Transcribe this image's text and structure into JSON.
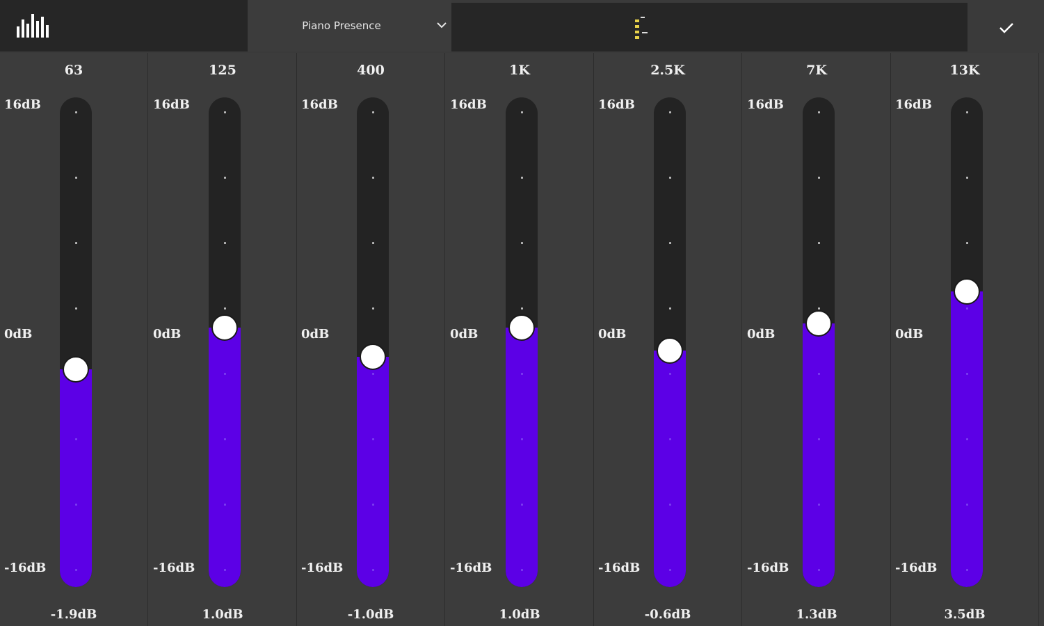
{
  "header": {
    "preset_label": "Piano Presence",
    "logo_icon": "equalizer-bars-icon",
    "dropdown_icon": "chevron-down-icon",
    "confirm_icon": "checkmark-icon",
    "mini_icon": "mini-level-icon"
  },
  "scale": {
    "max_label": "16dB",
    "zero_label": "0dB",
    "min_label": "-16dB",
    "max_db": 16,
    "min_db": -16
  },
  "colors": {
    "accent": "#5c00e6",
    "track": "#232323",
    "panel": "#3c3c3c",
    "header": "#262626"
  },
  "bands": [
    {
      "freq": "63",
      "value_label": "-1.9dB",
      "db": -1.9
    },
    {
      "freq": "125",
      "value_label": "1.0dB",
      "db": 1.0
    },
    {
      "freq": "400",
      "value_label": "-1.0dB",
      "db": -1.0
    },
    {
      "freq": "1K",
      "value_label": "1.0dB",
      "db": 1.0
    },
    {
      "freq": "2.5K",
      "value_label": "-0.6dB",
      "db": -0.6
    },
    {
      "freq": "7K",
      "value_label": "1.3dB",
      "db": 1.3
    },
    {
      "freq": "13K",
      "value_label": "3.5dB",
      "db": 3.5
    }
  ]
}
